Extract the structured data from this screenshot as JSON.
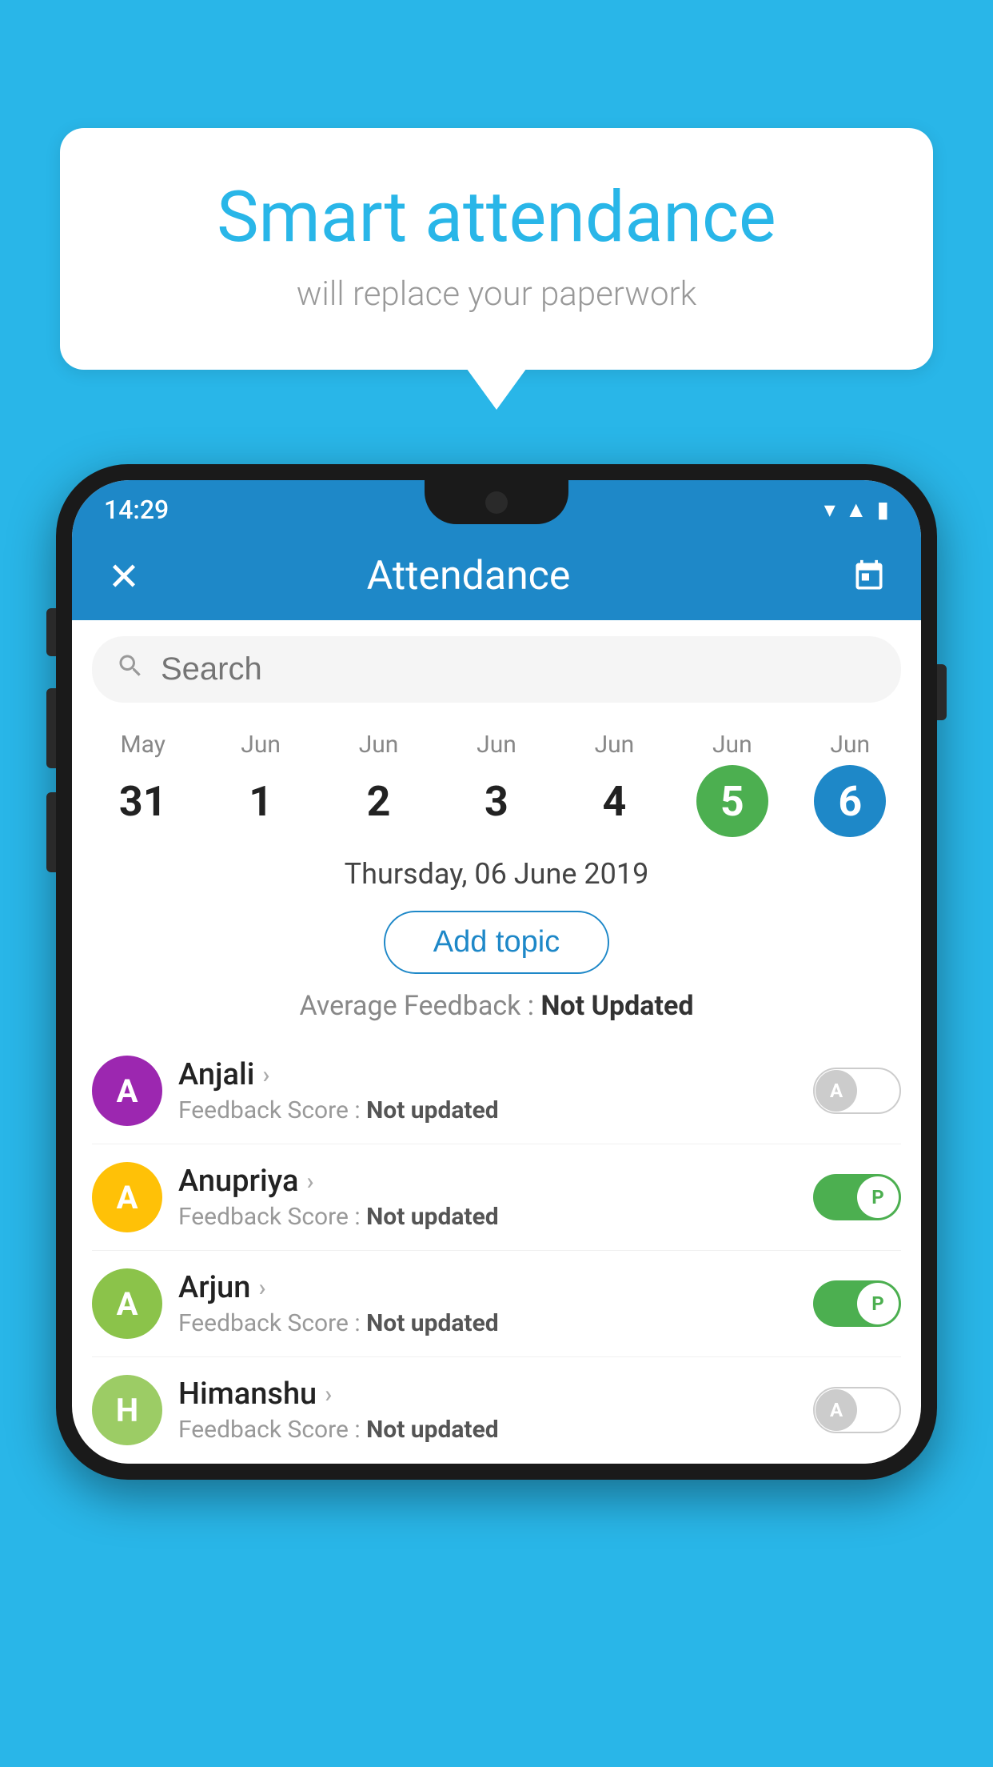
{
  "background_color": "#29B6E8",
  "speech_bubble": {
    "title": "Smart attendance",
    "subtitle": "will replace your paperwork"
  },
  "status_bar": {
    "time": "14:29",
    "icons": [
      "wifi",
      "signal",
      "battery"
    ]
  },
  "app_bar": {
    "title": "Attendance",
    "close_label": "✕",
    "calendar_label": "📅"
  },
  "search": {
    "placeholder": "Search"
  },
  "dates": [
    {
      "month": "May",
      "day": "31",
      "active": false
    },
    {
      "month": "Jun",
      "day": "1",
      "active": false
    },
    {
      "month": "Jun",
      "day": "2",
      "active": false
    },
    {
      "month": "Jun",
      "day": "3",
      "active": false
    },
    {
      "month": "Jun",
      "day": "4",
      "active": false
    },
    {
      "month": "Jun",
      "day": "5",
      "active": "green"
    },
    {
      "month": "Jun",
      "day": "6",
      "active": "blue"
    }
  ],
  "selected_date": "Thursday, 06 June 2019",
  "add_topic_label": "Add topic",
  "avg_feedback": {
    "label": "Average Feedback : ",
    "value": "Not Updated"
  },
  "students": [
    {
      "name": "Anjali",
      "avatar_letter": "A",
      "avatar_color": "#9C27B0",
      "feedback": "Feedback Score : ",
      "feedback_value": "Not updated",
      "toggle": "off",
      "toggle_letter": "A"
    },
    {
      "name": "Anupriya",
      "avatar_letter": "A",
      "avatar_color": "#FFC107",
      "feedback": "Feedback Score : ",
      "feedback_value": "Not updated",
      "toggle": "on",
      "toggle_letter": "P"
    },
    {
      "name": "Arjun",
      "avatar_letter": "A",
      "avatar_color": "#8BC34A",
      "feedback": "Feedback Score : ",
      "feedback_value": "Not updated",
      "toggle": "on",
      "toggle_letter": "P"
    },
    {
      "name": "Himanshu",
      "avatar_letter": "H",
      "avatar_color": "#9CCC65",
      "feedback": "Feedback Score : ",
      "feedback_value": "Not updated",
      "toggle": "off",
      "toggle_letter": "A"
    }
  ]
}
